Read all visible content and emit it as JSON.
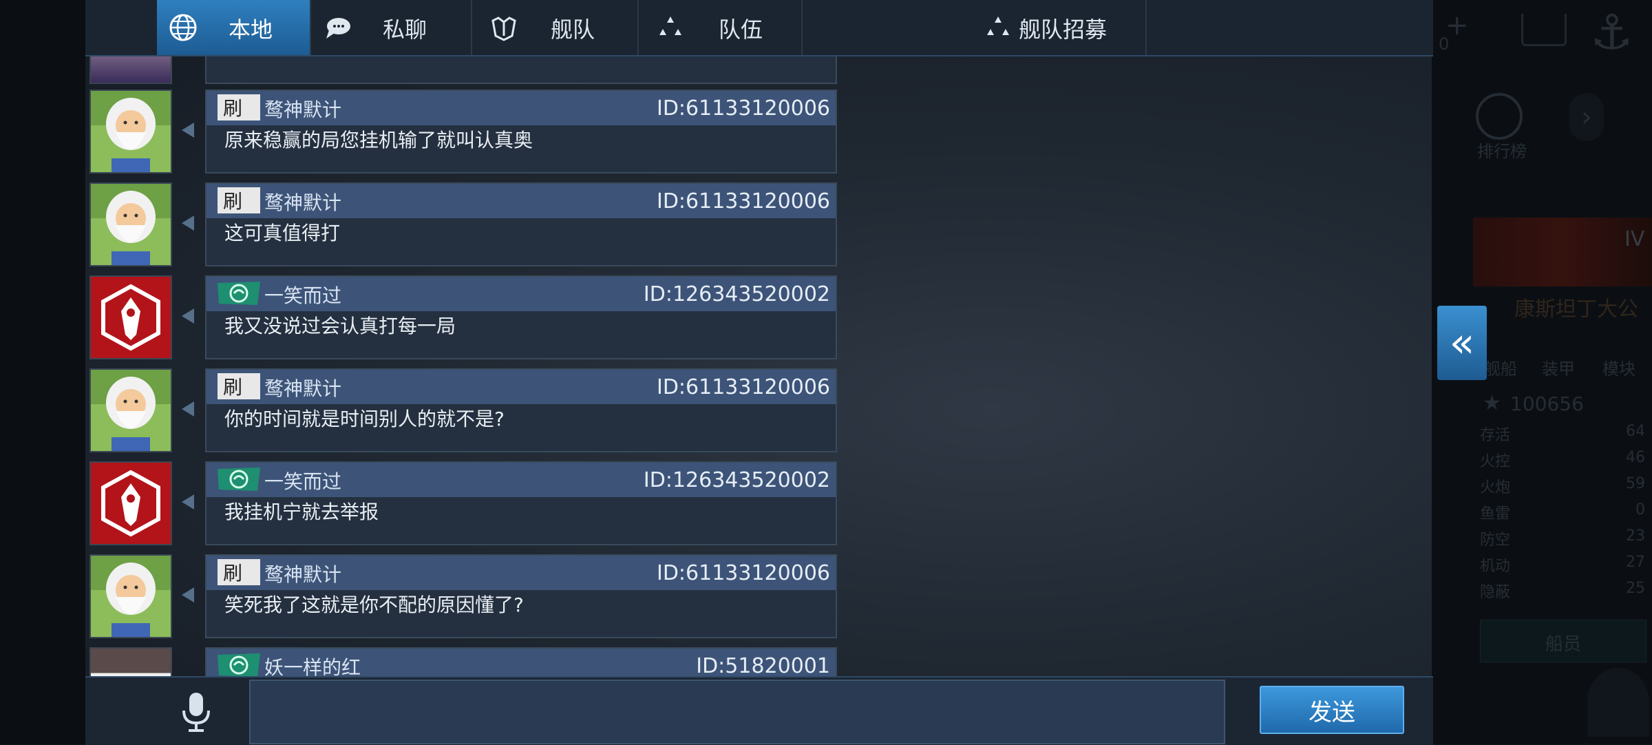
{
  "tabs": [
    {
      "label": "本地",
      "icon": "globe-icon",
      "active": true
    },
    {
      "label": "私聊",
      "icon": "speech-bubble-icon",
      "active": false
    },
    {
      "label": "舰队",
      "icon": "fleet-crest-icon",
      "active": false
    },
    {
      "label": "队伍",
      "icon": "team-dots-icon",
      "active": false
    },
    {
      "label": "舰队招募",
      "icon": "recruit-dots-icon",
      "active": false
    }
  ],
  "messages": [
    {
      "name": "鹜神默计",
      "id": "ID:61133120006",
      "text": "原来稳赢的局您挂机输了就叫认真奥",
      "avatar": "old-sage-avatar",
      "badge": "calligraphy-badge"
    },
    {
      "name": "鹜神默计",
      "id": "ID:61133120006",
      "text": "这可真值得打",
      "avatar": "old-sage-avatar",
      "badge": "calligraphy-badge"
    },
    {
      "name": "一笑而过",
      "id": "ID:126343520002",
      "text": "我又没说过会认真打每一局",
      "avatar": "red-emblem-avatar",
      "badge": "green-badge"
    },
    {
      "name": "鹜神默计",
      "id": "ID:61133120006",
      "text": "你的时间就是时间别人的就不是?",
      "avatar": "old-sage-avatar",
      "badge": "calligraphy-badge"
    },
    {
      "name": "一笑而过",
      "id": "ID:126343520002",
      "text": "我挂机宁就去举报",
      "avatar": "red-emblem-avatar",
      "badge": "green-badge"
    },
    {
      "name": "鹜神默计",
      "id": "ID:61133120006",
      "text": "笑死我了这就是你不配的原因懂了?",
      "avatar": "old-sage-avatar",
      "badge": "calligraphy-badge"
    },
    {
      "name": "妖一样的红",
      "id": "ID:51820001",
      "text": "",
      "avatar": "girl-avatar",
      "badge": "green-badge"
    }
  ],
  "input": {
    "placeholder": ""
  },
  "send_label": "发送",
  "right_panel": {
    "ship_name": "康斯坦丁大公",
    "tier": "IV",
    "tabs": [
      "舰船",
      "装甲",
      "模块"
    ],
    "rank_label": "排行榜",
    "rating": "100656",
    "stats": [
      {
        "label": "存活",
        "value": "64"
      },
      {
        "label": "火控",
        "value": "46"
      },
      {
        "label": "火炮",
        "value": "59"
      },
      {
        "label": "鱼雷",
        "value": "0"
      },
      {
        "label": "防空",
        "value": "23"
      },
      {
        "label": "机动",
        "value": "27"
      },
      {
        "label": "隐蔽",
        "value": "25"
      }
    ],
    "crew_label": "船员",
    "top_value": "0"
  },
  "colors": {
    "accent": "#2f7fbf",
    "header": "#3d5478",
    "bubble": "#243040"
  }
}
